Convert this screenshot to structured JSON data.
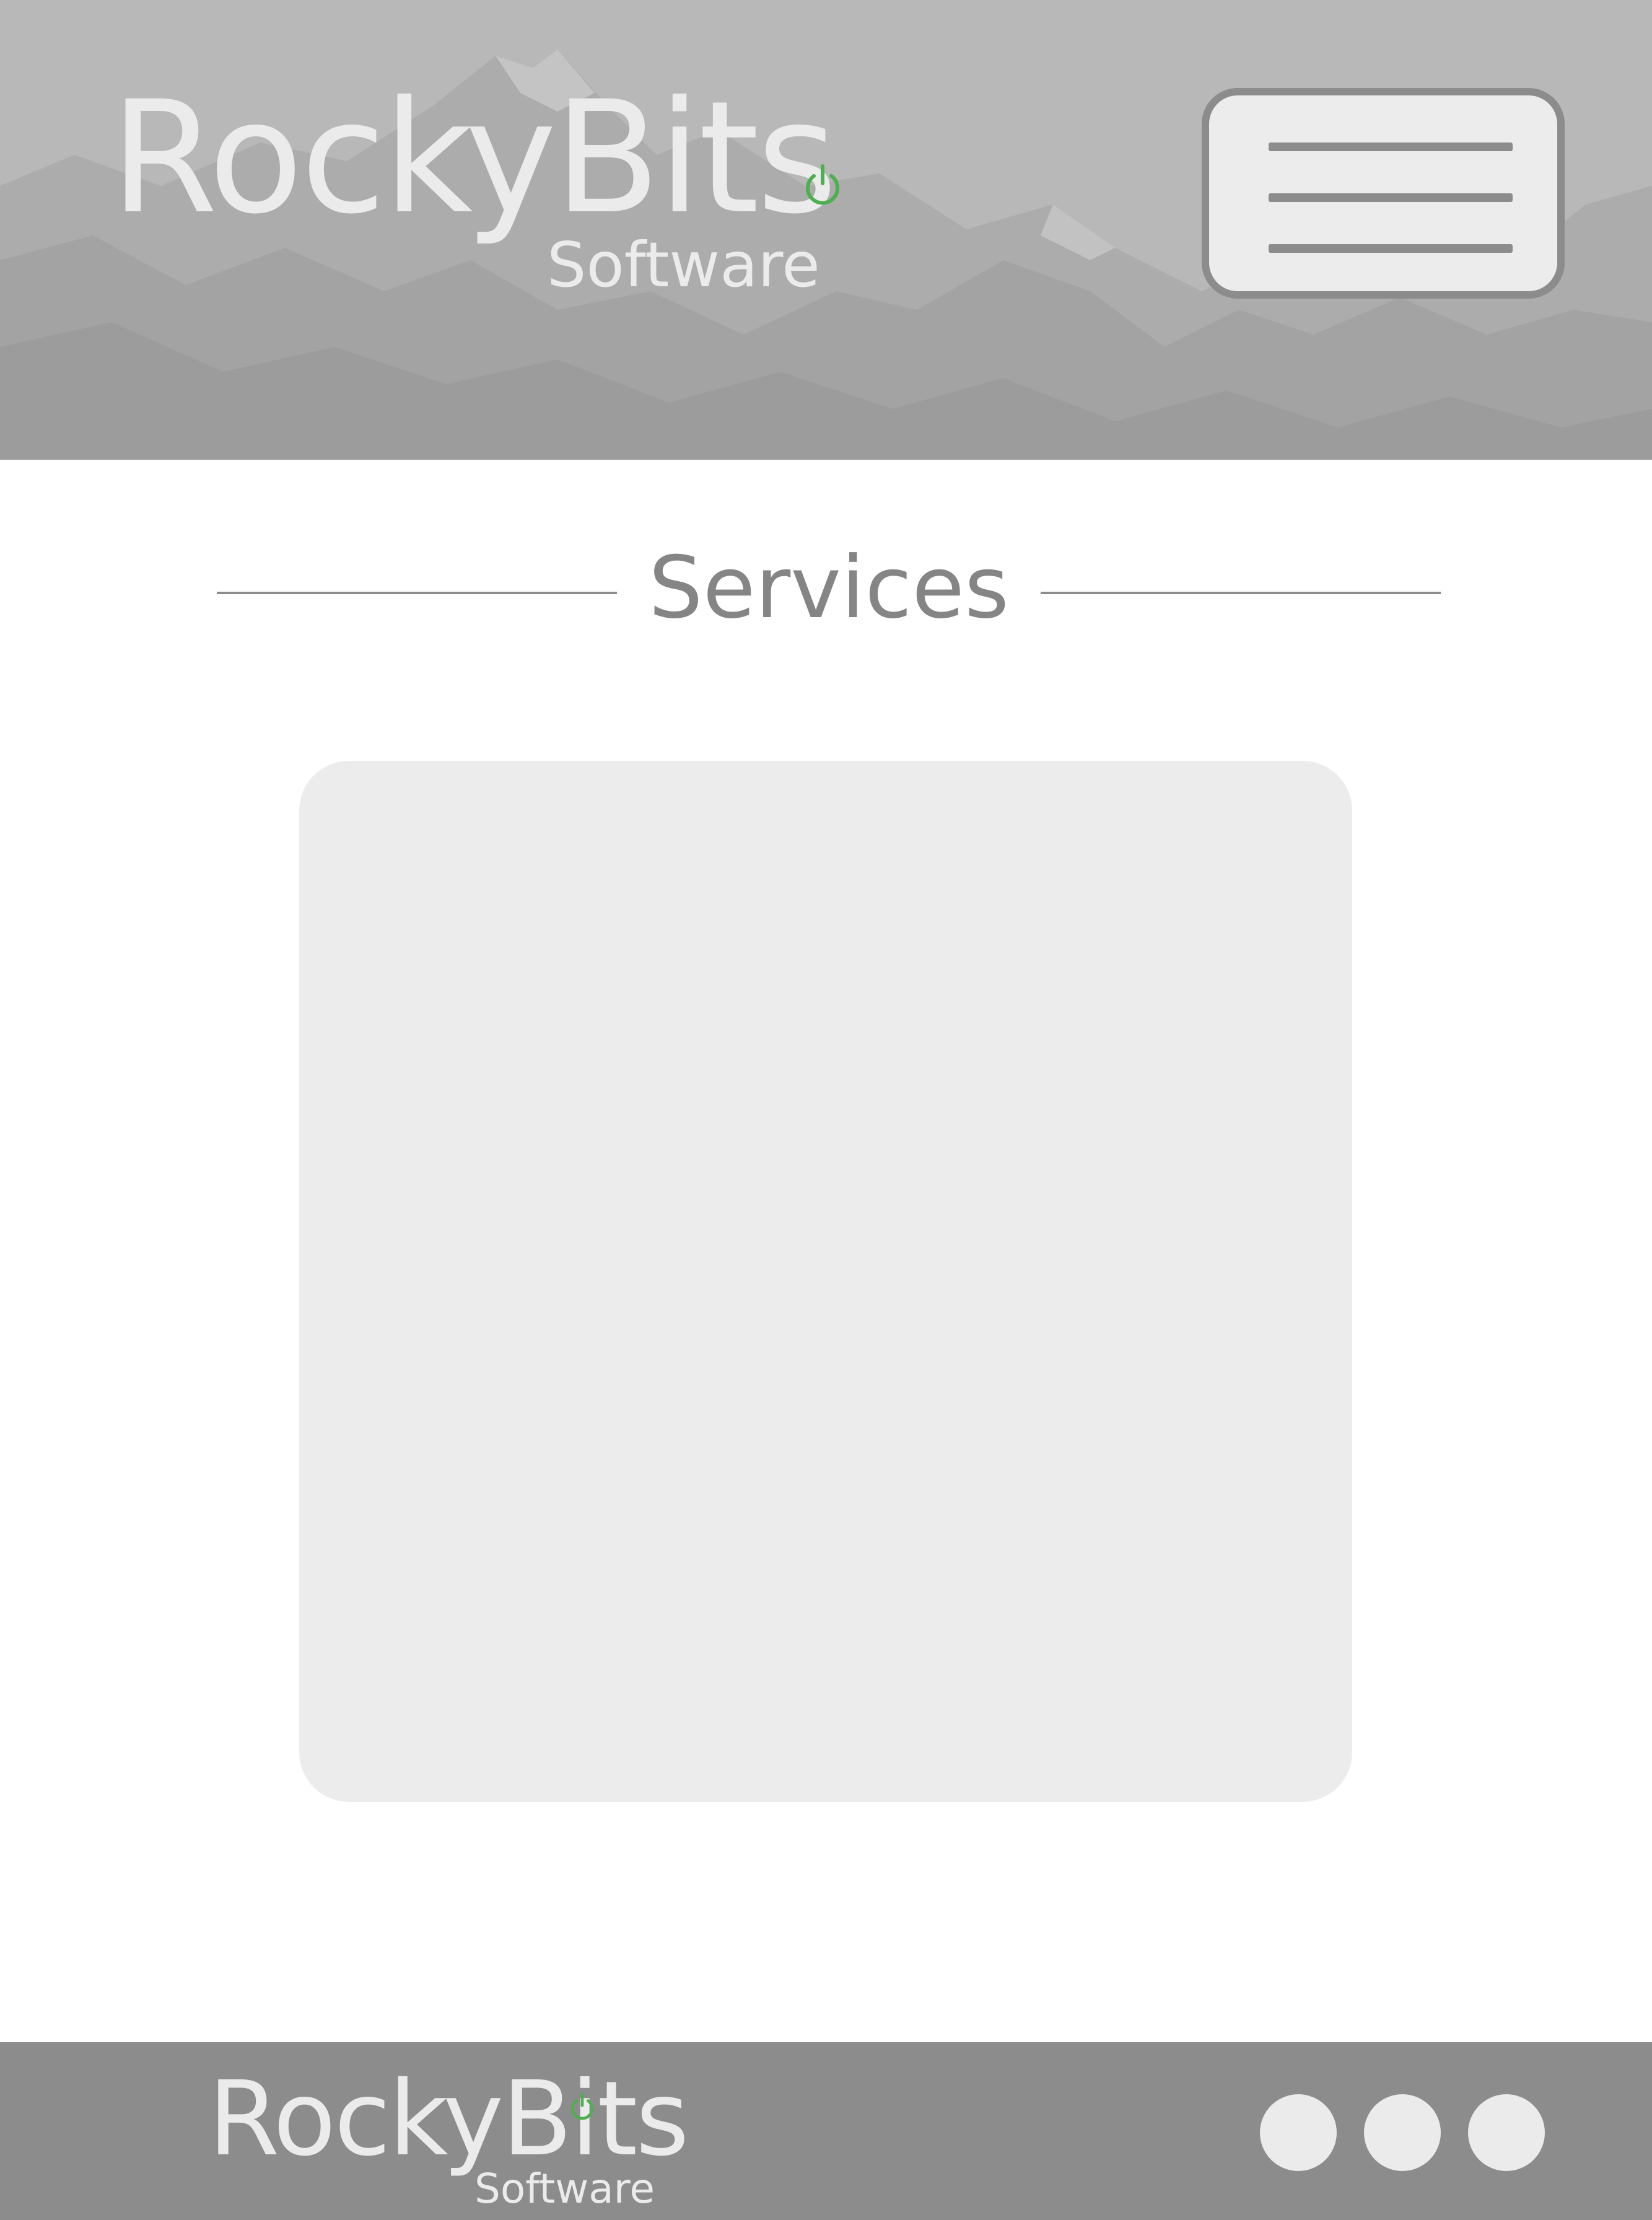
{
  "header": {
    "logo": {
      "brand": "RockyBits",
      "tagline": "Software",
      "icon": "power-icon",
      "icon_color": "#4caf50"
    },
    "menu_button": {
      "icon": "hamburger-menu-icon"
    },
    "background": "mountain-photo"
  },
  "main": {
    "section_title": "Services"
  },
  "footer": {
    "logo": {
      "brand": "RockyBits",
      "tagline": "Software",
      "icon": "power-icon",
      "icon_color": "#4caf50"
    },
    "social_icons": [
      "circle-icon",
      "circle-icon",
      "circle-icon"
    ]
  },
  "colors": {
    "header_bg": "#b8b8b8",
    "footer_bg": "#8c8c8c",
    "card_bg": "#ececec",
    "text_light": "#ebebeb",
    "heading_text": "#858585",
    "accent": "#4caf50"
  }
}
